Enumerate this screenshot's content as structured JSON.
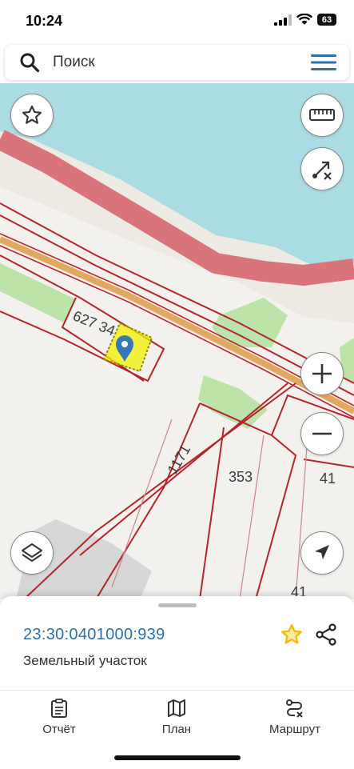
{
  "status_bar": {
    "time": "10:24",
    "battery": "63"
  },
  "search": {
    "placeholder": "Поиск"
  },
  "map": {
    "parcel_labels": [
      "627 34",
      "1171",
      "353",
      "41",
      "41"
    ]
  },
  "sheet": {
    "cadastral_number": "23:30:0401000:939",
    "object_type": "Земельный участок"
  },
  "tabs": [
    {
      "label": "Отчёт",
      "icon": "report-icon"
    },
    {
      "label": "План",
      "icon": "map-icon"
    },
    {
      "label": "Маршрут",
      "icon": "route-icon"
    }
  ],
  "colors": {
    "water": "#abdbe3",
    "shore_road": "#d9747b",
    "parcel_border": "#b5242b",
    "vegetation": "#bce3a8",
    "selected_parcel": "#f4f000",
    "accent": "#2f6fa8",
    "star": "#f5b800"
  }
}
